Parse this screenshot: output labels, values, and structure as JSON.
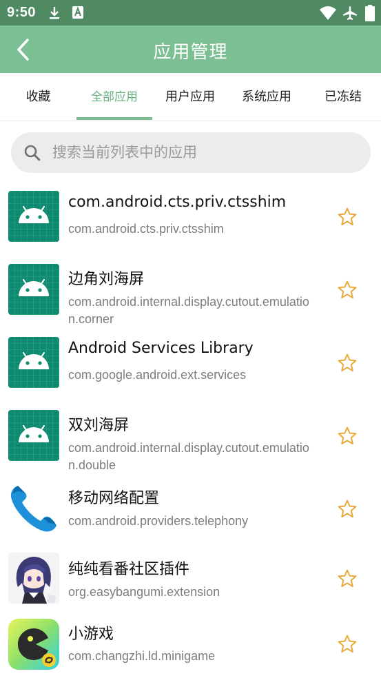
{
  "status_bar": {
    "time": "9:50",
    "icons": [
      "download-icon",
      "font-icon",
      "wifi-icon",
      "airplane-icon",
      "battery-icon"
    ]
  },
  "app_bar": {
    "title": "应用管理",
    "back_icon": "chevron-left-icon"
  },
  "tabs": [
    {
      "label": "收藏",
      "active": false
    },
    {
      "label": "全部应用",
      "active": true
    },
    {
      "label": "用户应用",
      "active": false
    },
    {
      "label": "系统应用",
      "active": false
    },
    {
      "label": "已冻结",
      "active": false
    }
  ],
  "search": {
    "placeholder": "搜索当前列表中的应用",
    "value": ""
  },
  "apps": [
    {
      "name": "com.android.cts.priv.ctsshim",
      "package": "com.android.cts.priv.ctsshim",
      "icon": "android-default-icon",
      "favorite": false
    },
    {
      "name": "边角刘海屏",
      "package": "com.android.internal.display.cutout.emulation.corner",
      "icon": "android-default-icon",
      "favorite": false
    },
    {
      "name": "Android Services Library",
      "package": "com.google.android.ext.services",
      "icon": "android-default-icon",
      "favorite": false
    },
    {
      "name": "双刘海屏",
      "package": "com.android.internal.display.cutout.emulation.double",
      "icon": "android-default-icon",
      "favorite": false
    },
    {
      "name": "移动网络配置",
      "package": "com.android.providers.telephony",
      "icon": "phone-icon",
      "favorite": false
    },
    {
      "name": "纯纯看番社区插件",
      "package": "org.easybangumi.extension",
      "icon": "anime-avatar-icon",
      "favorite": false
    },
    {
      "name": "小游戏",
      "package": "com.changzhi.ld.minigame",
      "icon": "minigame-icon",
      "favorite": false
    }
  ],
  "colors": {
    "status_bar": "#4f8a63",
    "app_bar": "#7cbf92",
    "tab_active": "#66b182",
    "star": "#e8a93a",
    "android_icon_bg": "#0d8a6f"
  }
}
